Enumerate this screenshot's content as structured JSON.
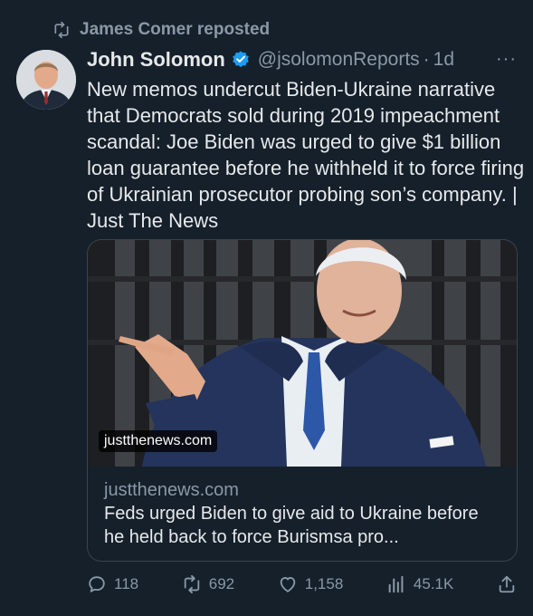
{
  "repost": {
    "icon": "repost-icon",
    "text": "James Comer reposted"
  },
  "author": {
    "name": "John Solomon",
    "handle": "@jsolomonReports",
    "separator": "·",
    "time": "1d",
    "verified_icon": "verified-badge-icon",
    "verified_color": "#1d9bf0"
  },
  "more_label": "···",
  "text": "New memos undercut Biden-Ukraine narrative that Democrats sold during 2019 impeachment scandal: Joe Biden was urged to give $1 billion loan guarantee before he withheld it to force firing of Ukrainian prosecutor probing son’s company. | Just The News",
  "card": {
    "image_domain": "justthenews.com",
    "domain": "justthenews.com",
    "title": "Feds urged Biden to give aid to Ukraine before he held back to force Burismsa pro..."
  },
  "actions": {
    "replies": "118",
    "reposts": "692",
    "likes": "1,158",
    "views": "45.1K"
  },
  "colors": {
    "background": "#15202b",
    "text": "#e7e9ea",
    "secondary": "#8b98a5",
    "border": "#38444d"
  }
}
